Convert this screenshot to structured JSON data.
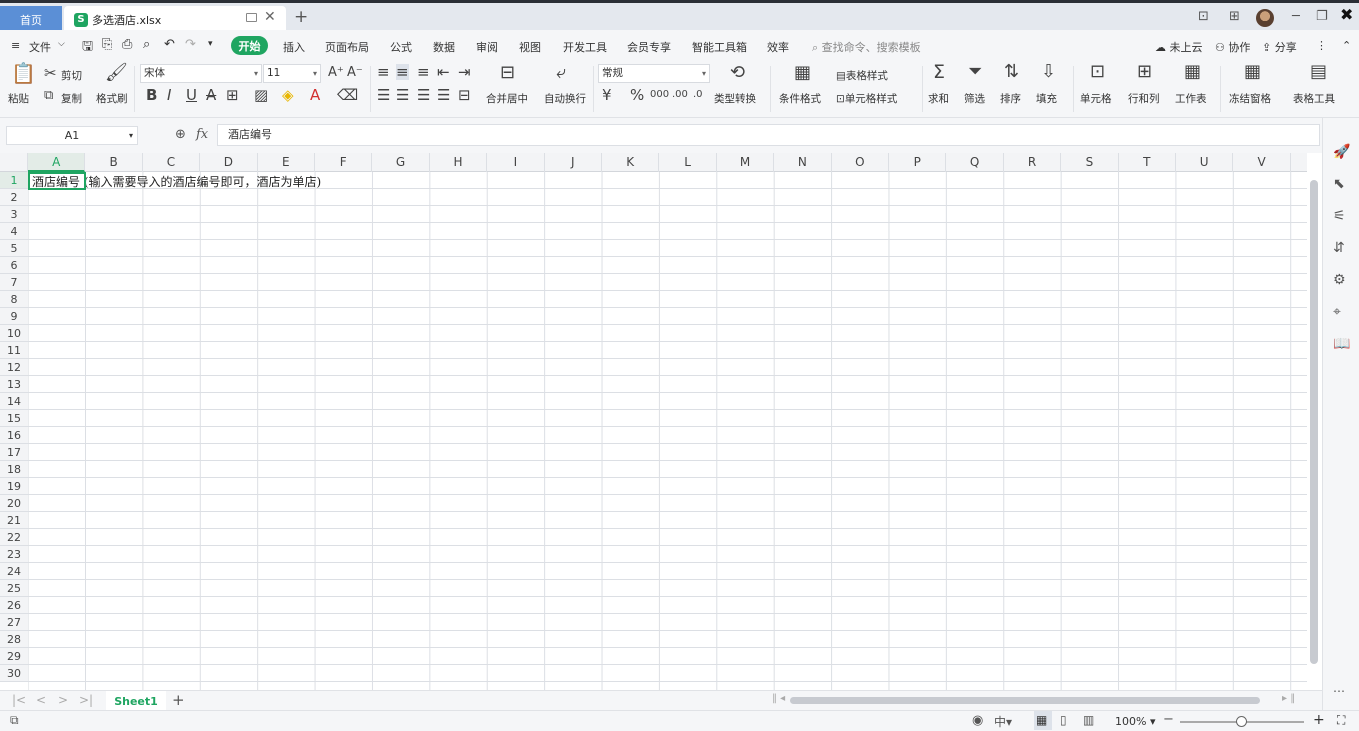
{
  "title_bar": {
    "home_tab": "首页",
    "file_tab": "多选酒店.xlsx",
    "file_logo": "S",
    "new_tab": "+"
  },
  "menu": {
    "file": "文件",
    "items": [
      "开始",
      "插入",
      "页面布局",
      "公式",
      "数据",
      "审阅",
      "视图",
      "开发工具",
      "会员专享",
      "智能工具箱",
      "效率"
    ],
    "search_placeholder": "查找命令、搜索模板",
    "cloud": "未上云",
    "collab": "协作",
    "share": "分享"
  },
  "ribbon": {
    "paste": "粘贴",
    "cut": "剪切",
    "copy": "复制",
    "format_painter": "格式刷",
    "font_name": "宋体",
    "font_size": "11",
    "merge_center": "合并居中",
    "auto_wrap": "自动换行",
    "number_format": "常规",
    "type_convert": "类型转换",
    "cond_format": "条件格式",
    "table_style": "表格样式",
    "cell_style": "单元格样式",
    "sum": "求和",
    "filter": "筛选",
    "sort": "排序",
    "fill": "填充",
    "cell": "单元格",
    "row_col": "行和列",
    "worksheet": "工作表",
    "freeze": "冻结窗格",
    "table_tools": "表格工具"
  },
  "formula_bar": {
    "name_box": "A1",
    "fx": "fx",
    "value": "酒店编号"
  },
  "grid": {
    "columns": [
      "A",
      "B",
      "C",
      "D",
      "E",
      "F",
      "G",
      "H",
      "I",
      "J",
      "K",
      "L",
      "M",
      "N",
      "O",
      "P",
      "Q",
      "R",
      "S",
      "T",
      "U",
      "V"
    ],
    "rows": [
      "1",
      "2",
      "3",
      "4",
      "5",
      "6",
      "7",
      "8",
      "9",
      "10",
      "11",
      "12",
      "13",
      "14",
      "15",
      "16",
      "17",
      "18",
      "19",
      "20",
      "21",
      "22",
      "23",
      "24",
      "25",
      "26",
      "27",
      "28",
      "29",
      "30"
    ],
    "a1_text": "酒店编号",
    "b1_text": "(输入需要导入的酒店编号即可，酒店为单店)"
  },
  "sheets": [
    "Sheet1"
  ],
  "status": {
    "zoom": "100%"
  },
  "colors": {
    "accent_green": "#1fa561",
    "home_tab_blue": "#5b8fd6"
  }
}
